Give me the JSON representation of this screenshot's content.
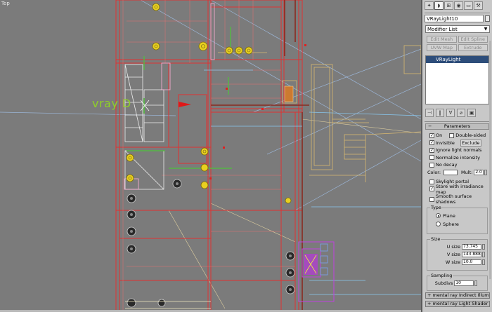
{
  "viewport": {
    "label": "Top",
    "light_label": "vray D"
  },
  "panel": {
    "tabs": [
      {
        "name": "create-tab-icon",
        "glyph": "✦"
      },
      {
        "name": "modify-tab-icon",
        "glyph": "◗"
      },
      {
        "name": "hierarchy-tab-icon",
        "glyph": "⊞"
      },
      {
        "name": "motion-tab-icon",
        "glyph": "◉"
      },
      {
        "name": "display-tab-icon",
        "glyph": "▭"
      },
      {
        "name": "utilities-tab-icon",
        "glyph": "⚒"
      }
    ],
    "object_name": "VRayLight10",
    "modifier_list": "Modifier List",
    "buttons": [
      "Edit Mesh",
      "Edit Spline",
      "UVW Map",
      "Extrude"
    ],
    "stack_item": "VRayLight"
  },
  "params": {
    "title": "Parameters",
    "on": "On",
    "double_sided": "Double-sided",
    "invisible": "Invisible",
    "exclude": "Exclude",
    "ignore_normals": "Ignore light normals",
    "normalize": "Normalize intensity",
    "no_decay": "No decay",
    "color": "Color:",
    "mult": "Mult:",
    "mult_value": "2.0",
    "skylight": "Skylight portal",
    "store_irr": "Store with irradiance map",
    "smooth_shadows": "Smooth surface shadows",
    "type_title": "Type",
    "plane": "Plane",
    "sphere": "Sphere",
    "size_title": "Size",
    "u_size": "U size",
    "u_value": "73.745",
    "v_size": "V size",
    "v_value": "143.888",
    "w_size": "W size",
    "w_value": "10.0",
    "sampling_title": "Sampling",
    "subdivs": "Subdivs",
    "subdivs_value": "10",
    "rollout_indirect": "mental ray Indirect Illumination",
    "rollout_light_shader": "mental ray Light Shader"
  },
  "checked": {
    "on": true,
    "double_sided": false,
    "invisible": true,
    "ignore_normals": true,
    "normalize": false,
    "no_decay": false,
    "skylight": false,
    "store_irr": true,
    "smooth_shadows": false
  }
}
